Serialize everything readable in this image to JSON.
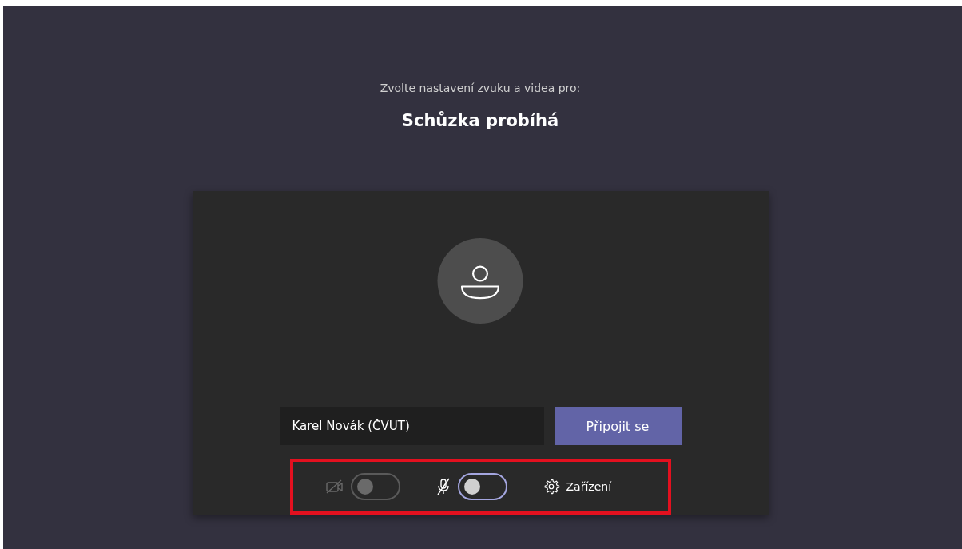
{
  "prompt": "Zvolte nastavení zvuku a videa pro:",
  "meeting_title": "Schůzka probíhá",
  "name_field": {
    "value": "Karel Novák (ČVUT)"
  },
  "join_button": "Připojit se",
  "controls": [
    {
      "kind": "camera",
      "on": false,
      "disabled": true
    },
    {
      "kind": "microphone",
      "on": false,
      "disabled": false
    }
  ],
  "devices_button": "Zařízení",
  "highlight": true
}
